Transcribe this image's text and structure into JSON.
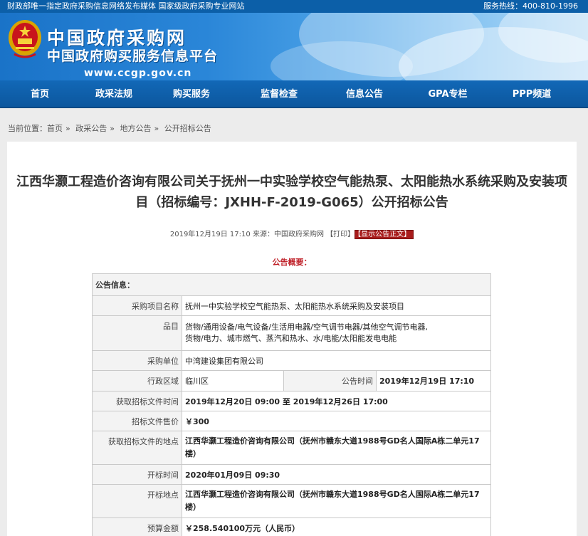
{
  "topbar": {
    "left_text": "财政部唯一指定政府采购信息网络发布媒体 国家级政府采购专业网站",
    "hotline": "服务热线：400-810-1996"
  },
  "banner": {
    "logo_title": "中国政府采购网",
    "logo_subtitle": "中国政府购买服务信息平台",
    "url": "www.ccgp.gov.cn"
  },
  "nav": {
    "items": [
      "首页",
      "政采法规",
      "购买服务",
      "监督检查",
      "信息公告",
      "GPA专栏",
      "PPP频道"
    ]
  },
  "breadcrumb": {
    "prefix": "当前位置：",
    "items": [
      "首页",
      "政采公告",
      "地方公告",
      "公开招标公告"
    ],
    "separator": "»"
  },
  "article": {
    "title": "江西华灏工程造价咨询有限公司关于抚州一中实验学校空气能热泵、太阳能热水系统采购及安装项目（招标编号：JXHH-F-2019-G065）公开招标公告",
    "date": "2019年12月19日 17:10",
    "source": "来源：中国政府采购网",
    "print": "【打印】",
    "show_body": "【显示公告正文】",
    "summary_label": "公告概要："
  },
  "info_table": {
    "header": "公告信息：",
    "project_name_label": "采购项目名称",
    "project_name": "抚州一中实验学校空气能热泵、太阳能热水系统采购及安装项目",
    "items_label": "品目",
    "items_line1": "货物/通用设备/电气设备/生活用电器/空气调节电器/其他空气调节电器,",
    "items_line2": "货物/电力、城市燃气、蒸汽和热水、水/电能/太阳能发电电能",
    "buyer_label": "采购单位",
    "buyer": "中湾建设集团有限公司",
    "region_label": "行政区域",
    "region": "临川区",
    "pub_time_label": "公告时间",
    "pub_time": "2019年12月19日 17:10",
    "doc_time_label": "获取招标文件时间",
    "doc_time": "2019年12月20日 09:00 至 2019年12月26日 17:00",
    "doc_price_label": "招标文件售价",
    "doc_price": "￥300",
    "doc_place_label": "获取招标文件的地点",
    "doc_place": "江西华灏工程造价咨询有限公司（抚州市赣东大道1988号GD名人国际A栋二单元17楼）",
    "open_time_label": "开标时间",
    "open_time": "2020年01月09日 09:30",
    "open_place_label": "开标地点",
    "open_place": "江西华灏工程造价咨询有限公司（抚州市赣东大道1988号GD名人国际A栋二单元17楼）",
    "budget_label": "预算金额",
    "budget": "￥258.540100万元（人民币）"
  }
}
